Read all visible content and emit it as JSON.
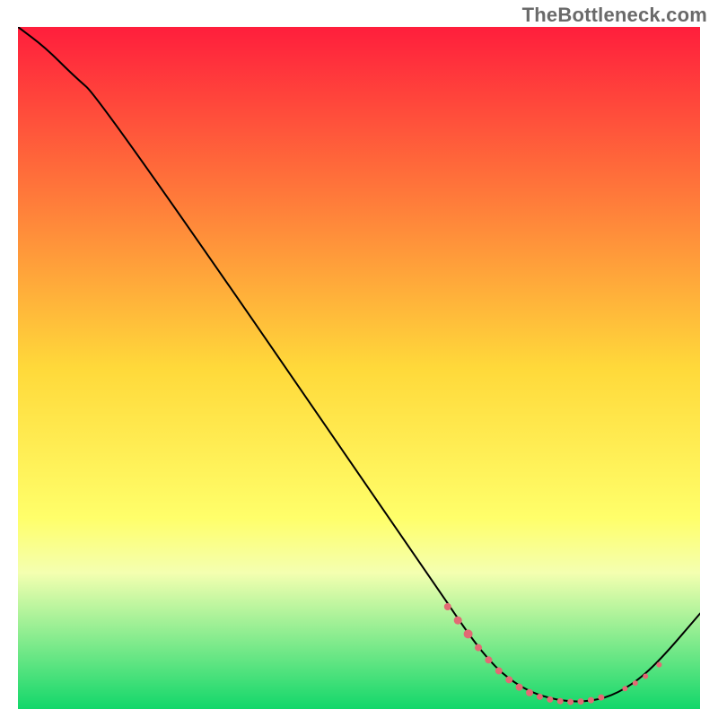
{
  "attribution": "TheBottleneck.com",
  "chart_data": {
    "type": "line",
    "title": "",
    "xlabel": "",
    "ylabel": "",
    "xlim": [
      0,
      100
    ],
    "ylim": [
      0,
      100
    ],
    "background_gradient": {
      "stops": [
        {
          "y": 0,
          "color": "#ff1e3c"
        },
        {
          "y": 25,
          "color": "#ff7a3a"
        },
        {
          "y": 50,
          "color": "#ffd93a"
        },
        {
          "y": 72,
          "color": "#ffff6a"
        },
        {
          "y": 80,
          "color": "#f4ffb0"
        },
        {
          "y": 100,
          "color": "#12d76a"
        }
      ]
    },
    "curve": [
      {
        "x": 0,
        "y": 100
      },
      {
        "x": 4,
        "y": 97
      },
      {
        "x": 8,
        "y": 93
      },
      {
        "x": 12,
        "y": 89.5
      },
      {
        "x": 60,
        "y": 20
      },
      {
        "x": 66,
        "y": 11
      },
      {
        "x": 70,
        "y": 6
      },
      {
        "x": 74,
        "y": 3
      },
      {
        "x": 78,
        "y": 1.5
      },
      {
        "x": 82,
        "y": 1
      },
      {
        "x": 86,
        "y": 1.5
      },
      {
        "x": 90,
        "y": 3.5
      },
      {
        "x": 94,
        "y": 7
      },
      {
        "x": 100,
        "y": 14
      }
    ],
    "markers": [
      {
        "x": 63,
        "y": 15,
        "r": 4
      },
      {
        "x": 64.5,
        "y": 13,
        "r": 4.5
      },
      {
        "x": 66,
        "y": 11,
        "r": 5
      },
      {
        "x": 67.5,
        "y": 9,
        "r": 4
      },
      {
        "x": 69,
        "y": 7.2,
        "r": 4
      },
      {
        "x": 70.5,
        "y": 5.6,
        "r": 4
      },
      {
        "x": 72,
        "y": 4.3,
        "r": 4
      },
      {
        "x": 73.5,
        "y": 3.2,
        "r": 4
      },
      {
        "x": 75,
        "y": 2.4,
        "r": 4
      },
      {
        "x": 76.5,
        "y": 1.8,
        "r": 3.5
      },
      {
        "x": 78,
        "y": 1.4,
        "r": 3.5
      },
      {
        "x": 79.5,
        "y": 1.15,
        "r": 3.5
      },
      {
        "x": 81,
        "y": 1.05,
        "r": 3.5
      },
      {
        "x": 82.5,
        "y": 1.1,
        "r": 3.5
      },
      {
        "x": 84,
        "y": 1.3,
        "r": 3.5
      },
      {
        "x": 85.5,
        "y": 1.7,
        "r": 3.5
      },
      {
        "x": 89,
        "y": 3,
        "r": 3
      },
      {
        "x": 90.5,
        "y": 3.8,
        "r": 3
      },
      {
        "x": 92,
        "y": 4.8,
        "r": 3
      },
      {
        "x": 94,
        "y": 6.5,
        "r": 3
      }
    ],
    "marker_color": "#e26a74",
    "curve_color": "#000000",
    "curve_width": 2
  }
}
